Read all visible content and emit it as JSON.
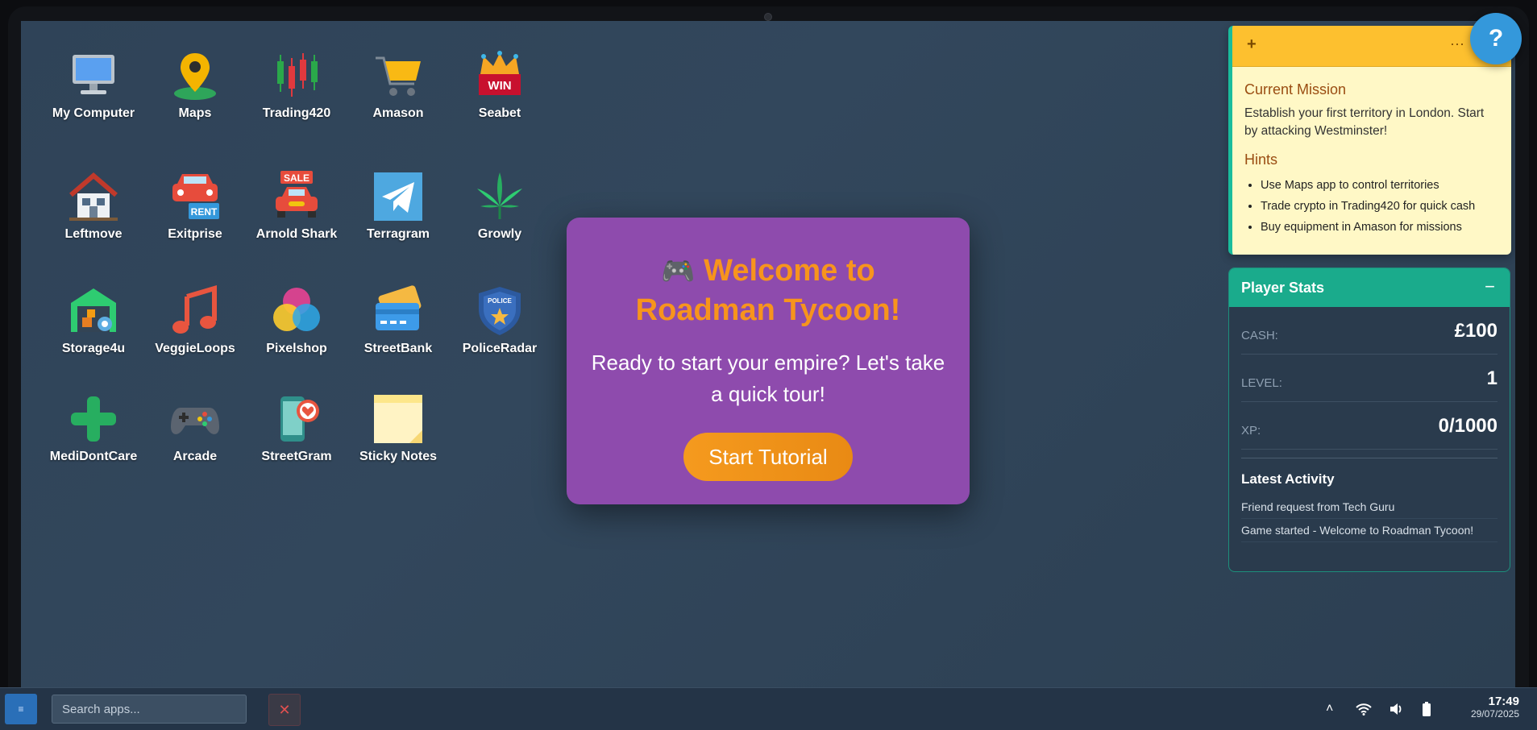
{
  "desktop": {
    "apps": [
      {
        "label": "My Computer",
        "icon": "computer-icon"
      },
      {
        "label": "Maps",
        "icon": "map-pin-icon"
      },
      {
        "label": "Trading420",
        "icon": "candlestick-icon"
      },
      {
        "label": "Amason",
        "icon": "shopping-cart-icon"
      },
      {
        "label": "Seabet",
        "icon": "crown-win-icon"
      },
      {
        "label": "Leftmove",
        "icon": "house-icon"
      },
      {
        "label": "Exitprise",
        "icon": "rent-car-icon"
      },
      {
        "label": "Arnold Shark",
        "icon": "sale-car-icon"
      },
      {
        "label": "Terragram",
        "icon": "paper-plane-icon"
      },
      {
        "label": "Growly",
        "icon": "leaf-icon"
      },
      {
        "label": "Storage4u",
        "icon": "warehouse-icon"
      },
      {
        "label": "VeggieLoops",
        "icon": "music-note-icon"
      },
      {
        "label": "Pixelshop",
        "icon": "color-circles-icon"
      },
      {
        "label": "StreetBank",
        "icon": "credit-card-icon"
      },
      {
        "label": "PoliceRadar",
        "icon": "police-badge-icon"
      },
      {
        "label": "MediDontCare",
        "icon": "medical-cross-icon"
      },
      {
        "label": "Arcade",
        "icon": "gamepad-icon"
      },
      {
        "label": "StreetGram",
        "icon": "phone-heart-icon"
      },
      {
        "label": "Sticky Notes",
        "icon": "sticky-note-icon"
      }
    ]
  },
  "modal": {
    "emoji": "🎮",
    "title": "Welcome to Roadman Tycoon!",
    "subtitle": "Ready to start your empire? Let's take a quick tour!",
    "button": "Start Tutorial"
  },
  "sticky": {
    "add": "+",
    "more": "···",
    "mission_heading": "Current Mission",
    "mission_text": "Establish your first territory in London. Start by attacking Westminster!",
    "hints_heading": "Hints",
    "hints": [
      "Use Maps app to control territories",
      "Trade crypto in Trading420 for quick cash",
      "Buy equipment in Amason for missions"
    ]
  },
  "help": {
    "label": "?"
  },
  "stats": {
    "title": "Player Stats",
    "minimize": "−",
    "cash_label": "CASH:",
    "cash_value": "£100",
    "level_label": "LEVEL:",
    "level_value": "1",
    "xp_label": "XP:",
    "xp_value": "0/1000",
    "activity_heading": "Latest Activity",
    "activity": [
      "Friend request from Tech Guru",
      "Game started - Welcome to Roadman Tycoon!"
    ]
  },
  "taskbar": {
    "start_label": "≡",
    "search_placeholder": "Search apps...",
    "close_label": "✕",
    "tray_chevron": "˄",
    "time": "17:49",
    "date": "29/07/2025"
  },
  "colors": {
    "accent": "#f7941d",
    "modal_bg": "#8e4bad",
    "teal": "#1aab8c",
    "sticky_bg": "#fff8c6",
    "help": "#3498db"
  }
}
